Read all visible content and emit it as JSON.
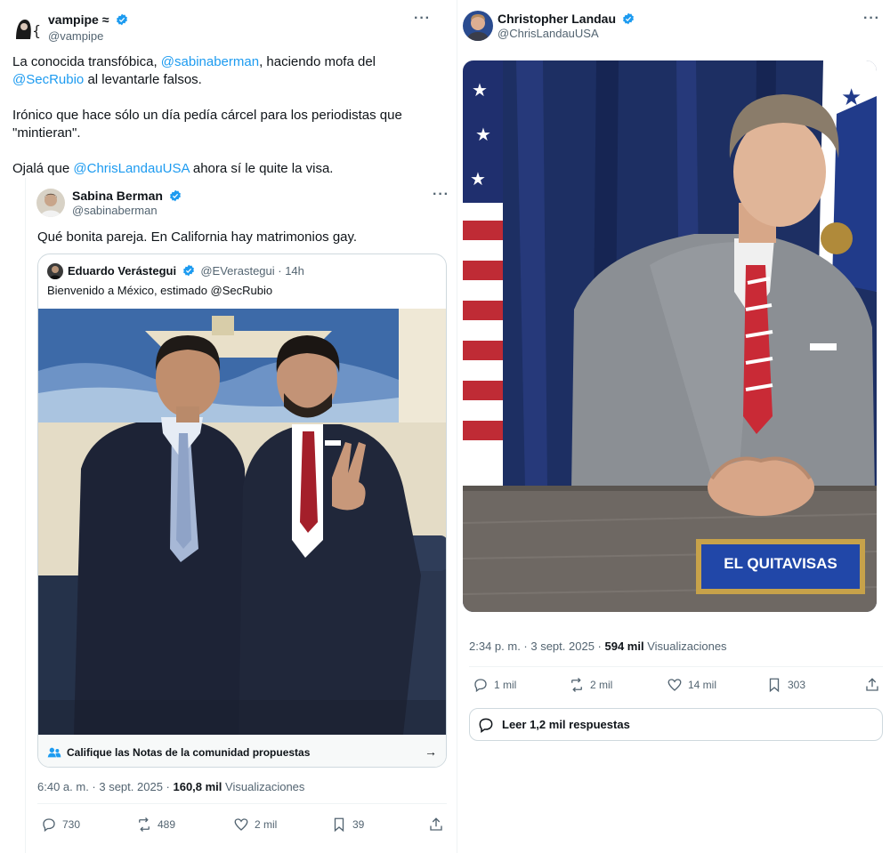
{
  "left": {
    "user": {
      "name": "vampipe ≈",
      "handle": "@vampipe"
    },
    "text": {
      "p1_a": "La conocida transfóbica, ",
      "p1_mention": "@sabinaberman",
      "p1_b": ", haciendo mofa del",
      "p2_mention": "@SecRubio",
      "p2_b": " al levantarle falsos.",
      "p3": "Irónico que hace sólo un día pedía cárcel para los periodistas que",
      "p4": "\"mintieran\".",
      "p5_a": "Ojalá que ",
      "p5_mention": "@ChrisLandauUSA",
      "p5_b": " ahora sí le quite la visa."
    },
    "quoted": {
      "user": {
        "name": "Sabina Berman",
        "handle": "@sabinaberman"
      },
      "text": "Qué bonita pareja.  En California hay matrimonios gay.",
      "inner": {
        "name": "Eduardo Verástegui",
        "handle": "@EVerastegui · 14h",
        "text": "Bienvenido a México, estimado @SecRubio"
      },
      "notes_label": "Califique las Notas de la comunidad propuestas",
      "meta": {
        "time": "6:40 a. m. · 3 sept. 2025 · ",
        "views": "160,8 mil",
        "views_label": " Visualizaciones"
      },
      "actions": {
        "replies": "730",
        "reposts": "489",
        "likes": "2 mil",
        "bookmarks": "39"
      }
    }
  },
  "right": {
    "user": {
      "name": "Christopher Landau",
      "handle": "@ChrisLandauUSA"
    },
    "nameplate": "EL QUITAVISAS",
    "meta": {
      "time": "2:34 p. m. · 3 sept. 2025 · ",
      "views": "594 mil",
      "views_label": " Visualizaciones"
    },
    "actions": {
      "replies": "1 mil",
      "reposts": "2 mil",
      "likes": "14 mil",
      "bookmarks": "303"
    },
    "read_replies": "Leer 1,2 mil respuestas"
  },
  "colors": {
    "link": "#1d9bf0",
    "verified": "#1d9bf0",
    "muted": "#536471"
  }
}
